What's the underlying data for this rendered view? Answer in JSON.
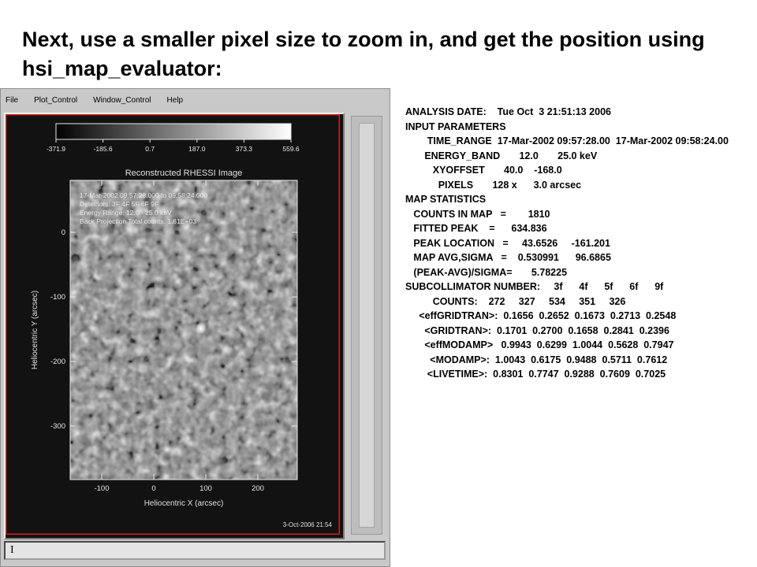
{
  "slide": {
    "title": "Next, use a smaller pixel size to zoom in, and get the position using hsi_map_evaluator:"
  },
  "window": {
    "menu": [
      "File",
      "Plot_Control",
      "Window_Control",
      "Help"
    ],
    "command_text": "I"
  },
  "plot": {
    "colorbar_ticks": [
      "-371.9",
      "-185.6",
      "0.7",
      "187.0",
      "373.3",
      "559.6"
    ],
    "title": "Reconstructed RHESSI Image",
    "annotations": [
      "17-Mar-2002 09:57:28.000 to 09:58:24.000",
      "Detectors: 3F 4F 5F 6F   9F",
      "Energy Range: 12.0 - 25.0 keV",
      "Back Projection   Total counts: 1.81E+03"
    ],
    "x_label": "Heliocentric X (arcsec)",
    "y_label": "Heliocentric Y (arcsec)",
    "x_ticks": [
      "-100",
      "0",
      "100",
      "200"
    ],
    "y_ticks": [
      "0",
      "-100",
      "-200",
      "-300"
    ],
    "date_stamp": "3-Oct-2006 21:54",
    "colors": {
      "frame_red": "#d21e1e",
      "text": "#e0e0e0",
      "axis": "#e8e8e8"
    }
  },
  "stats": [
    "ANALYSIS DATE:    Tue Oct  3 21:51:13 2006",
    "INPUT PARAMETERS",
    "        TIME_RANGE  17-Mar-2002 09:57:28.00  17-Mar-2002 09:58:24.00",
    "       ENERGY_BAND       12.0       25.0 keV",
    "          XYOFFSET       40.0    -168.0",
    "            PIXELS       128 x      3.0 arcsec",
    "MAP STATISTICS",
    "   COUNTS IN MAP   =        1810",
    "   FITTED PEAK    =      634.836",
    "   PEAK LOCATION   =     43.6526     -161.201",
    "   MAP AVG,SIGMA   =    0.530991      96.6865",
    "   (PEAK-AVG)/SIGMA=       5.78225",
    "SUBCOLLIMATOR NUMBER:     3f      4f      5f      6f      9f",
    "          COUNTS:    272     327     534     351     326",
    "     <effGRIDTRAN>:  0.1656  0.2652  0.1673  0.2713  0.2548",
    "       <GRIDTRAN>:  0.1701  0.2700  0.1658  0.2841  0.2396",
    "       <effMODAMP>   0.9943  0.6299  1.0044  0.5628  0.7947",
    "         <MODAMP>:  1.0043  0.6175  0.9488  0.5711  0.7612",
    "        <LIVETIME>:  0.8301  0.7747  0.9288  0.7609  0.7025"
  ]
}
